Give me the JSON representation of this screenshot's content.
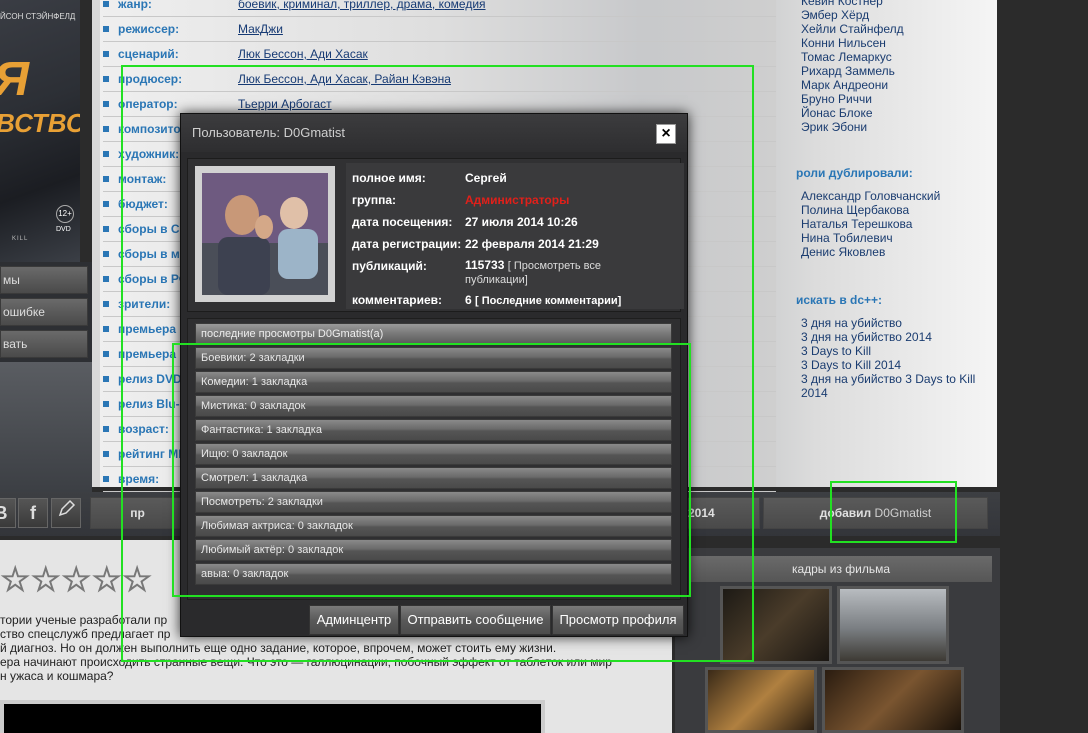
{
  "poster": {
    "actors": "ЙСОН СТЭЙНФЕЛД",
    "title1": "Я",
    "title2": "ВСТВО",
    "age": "12+",
    "dvd": "DVD",
    "kill": "KILL"
  },
  "left_buttons": [
    "мы",
    "ошибке",
    "вать"
  ],
  "info_rows": [
    {
      "key": "жанр:",
      "value": "боевик, криминал, триллер, драма, комедия"
    },
    {
      "key": "режиссер:",
      "value": "МакДжи"
    },
    {
      "key": "сценарий:",
      "value": "Люк Бессон, Ади Хасак"
    },
    {
      "key": "продюсер:",
      "value": "Люк Бессон, Ади Хасак, Райан Кэвэна"
    },
    {
      "key": "оператор:",
      "value": "Тьерри Арбогаст"
    },
    {
      "key": "композитор:",
      "value": ""
    },
    {
      "key": "художник:",
      "value": ""
    },
    {
      "key": "монтаж:",
      "value": ""
    },
    {
      "key": "бюджет:",
      "value": ""
    },
    {
      "key": "сборы в США:",
      "value": ""
    },
    {
      "key": "сборы в мире:",
      "value": ""
    },
    {
      "key": "сборы в РФ:",
      "value": ""
    },
    {
      "key": "зрители:",
      "value": ""
    },
    {
      "key": "премьера (мир):",
      "value": ""
    },
    {
      "key": "премьера (РФ):",
      "value": ""
    },
    {
      "key": "релиз DVD:",
      "value": ""
    },
    {
      "key": "релиз Blu-Ray:",
      "value": ""
    },
    {
      "key": "возраст:",
      "value": ""
    },
    {
      "key": "рейтинг MPAA:",
      "value": ""
    },
    {
      "key": "время:",
      "value": ""
    }
  ],
  "cast_list": [
    "Кевин Костнер",
    "Эмбер Хёрд",
    "Хейли Стайнфелд",
    "Конни Нильсен",
    "Томас Лемаркус",
    "Рихард Заммель",
    "Марк Андреони",
    "Бруно Риччи",
    "Йонас Блоке",
    "Эрик Эбони"
  ],
  "dub_heading": "роли дублировали:",
  "dub_list": [
    "Александр Головчанский",
    "Полина Щербакова",
    "Наталья Терешкова",
    "Нина Тобилевич",
    "Денис Яковлев"
  ],
  "dc_heading": "искать в dc++:",
  "dc_list": [
    "3 дня на убийство",
    "3 дня на убийство 2014",
    "3 Days to Kill",
    "3 Days to Kill 2014",
    "3 дня на убийство 3 Days to Kill",
    "2014"
  ],
  "bar": {
    "icon_b": "В",
    "icon_f": "f",
    "partial_left": "пр",
    "partial_mid": "2014",
    "added_by": "добавил",
    "added_user": "D0Gmatist"
  },
  "stars": "☆☆☆☆☆",
  "description": [
    "тории ученые разработали пр",
    "ство спецслужб предлагает пр",
    "й диагноз. Но он должен выполнить еще одно задание, которое, впрочем, может стоить ему жизни.",
    "ера начинают происходить странные вещи. Что это — галлюцинации, побочный эффект от таблеток или мир",
    "н ужаса и кошмара?"
  ],
  "frames_heading": "кадры из фильма",
  "popup": {
    "title": "Пользователь: D0Gmatist",
    "close": "×",
    "fields": [
      {
        "label": "полное имя:",
        "value": "Сергей"
      },
      {
        "label": "группа:",
        "value": "Администраторы"
      },
      {
        "label": "дата посещения:",
        "value": "27 июля 2014 10:26"
      },
      {
        "label": "дата регистрации:",
        "value": "22 февраля 2014 21:29"
      }
    ],
    "pubs_label": "публикаций:",
    "pubs_count": "115733",
    "pubs_link": "[ Просмотреть все публикации]",
    "comments_label": "комментариев:",
    "comments_count": "6",
    "comments_link": "[ Последние комментарии]",
    "list_header": "последние просмотры D0Gmatist(a)",
    "bookmarks": [
      "Боевики: 2 закладки",
      "Комедии: 1 закладка",
      "Мистика: 0 закладок",
      "Фантастика: 1 закладка",
      "Ищю: 0 закладок",
      "Смотрел: 1 закладка",
      "Посмотреть: 2 закладки",
      "Любимая актриса: 0 закладок",
      "Любимый актёр: 0 закладок",
      "авыа: 0 закладок"
    ],
    "buttons": {
      "admin": "Админцентр",
      "message": "Отправить сообщение",
      "profile": "Просмотр профиля"
    }
  }
}
